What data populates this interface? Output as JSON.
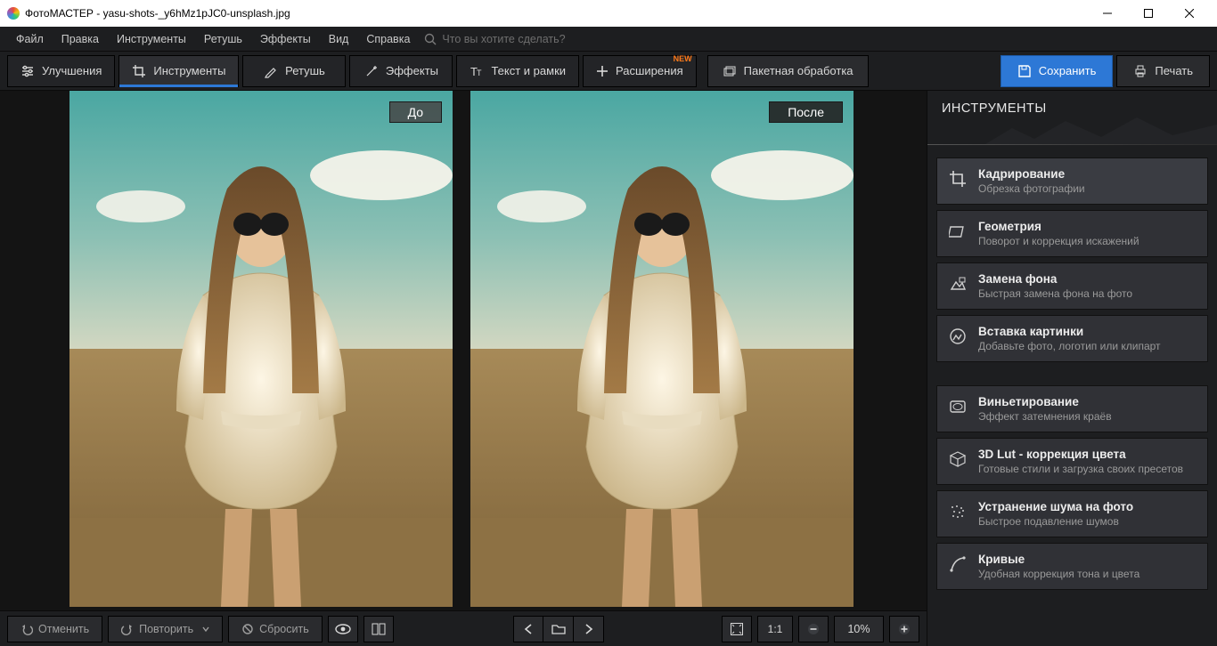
{
  "title": "ФотоМАСТЕР - yasu-shots-_y6hMz1pJC0-unsplash.jpg",
  "menu": {
    "file": "Файл",
    "edit": "Правка",
    "tools": "Инструменты",
    "retouch": "Ретушь",
    "effects": "Эффекты",
    "view": "Вид",
    "help": "Справка"
  },
  "search": {
    "placeholder": "Что вы хотите сделать?"
  },
  "tabs": {
    "enhance": "Улучшения",
    "tools": "Инструменты",
    "retouch": "Ретушь",
    "effects": "Эффекты",
    "text": "Текст и рамки",
    "extensions": "Расширения",
    "new_badge": "NEW"
  },
  "batch": "Пакетная обработка",
  "save": "Сохранить",
  "print": "Печать",
  "compare": {
    "before": "До",
    "after": "После"
  },
  "bottom": {
    "undo": "Отменить",
    "redo": "Повторить",
    "reset": "Сбросить",
    "one_to_one": "1:1",
    "zoom": "10%"
  },
  "panel": {
    "title": "ИНСТРУМЕНТЫ",
    "tools": [
      {
        "title": "Кадрирование",
        "desc": "Обрезка фотографии",
        "icon": "crop-icon"
      },
      {
        "title": "Геометрия",
        "desc": "Поворот и коррекция искажений",
        "icon": "geometry-icon"
      },
      {
        "title": "Замена фона",
        "desc": "Быстрая замена фона на фото",
        "icon": "replace-bg-icon"
      },
      {
        "title": "Вставка картинки",
        "desc": "Добавьте фото, логотип или клипарт",
        "icon": "insert-image-icon"
      },
      {
        "title": "Виньетирование",
        "desc": "Эффект затемнения краёв",
        "icon": "vignette-icon"
      },
      {
        "title": "3D Lut - коррекция цвета",
        "desc": "Готовые стили и загрузка своих пресетов",
        "icon": "lut-icon"
      },
      {
        "title": "Устранение шума на фото",
        "desc": "Быстрое подавление шумов",
        "icon": "denoise-icon"
      },
      {
        "title": "Кривые",
        "desc": "Удобная коррекция тона и цвета",
        "icon": "curves-icon"
      }
    ]
  }
}
